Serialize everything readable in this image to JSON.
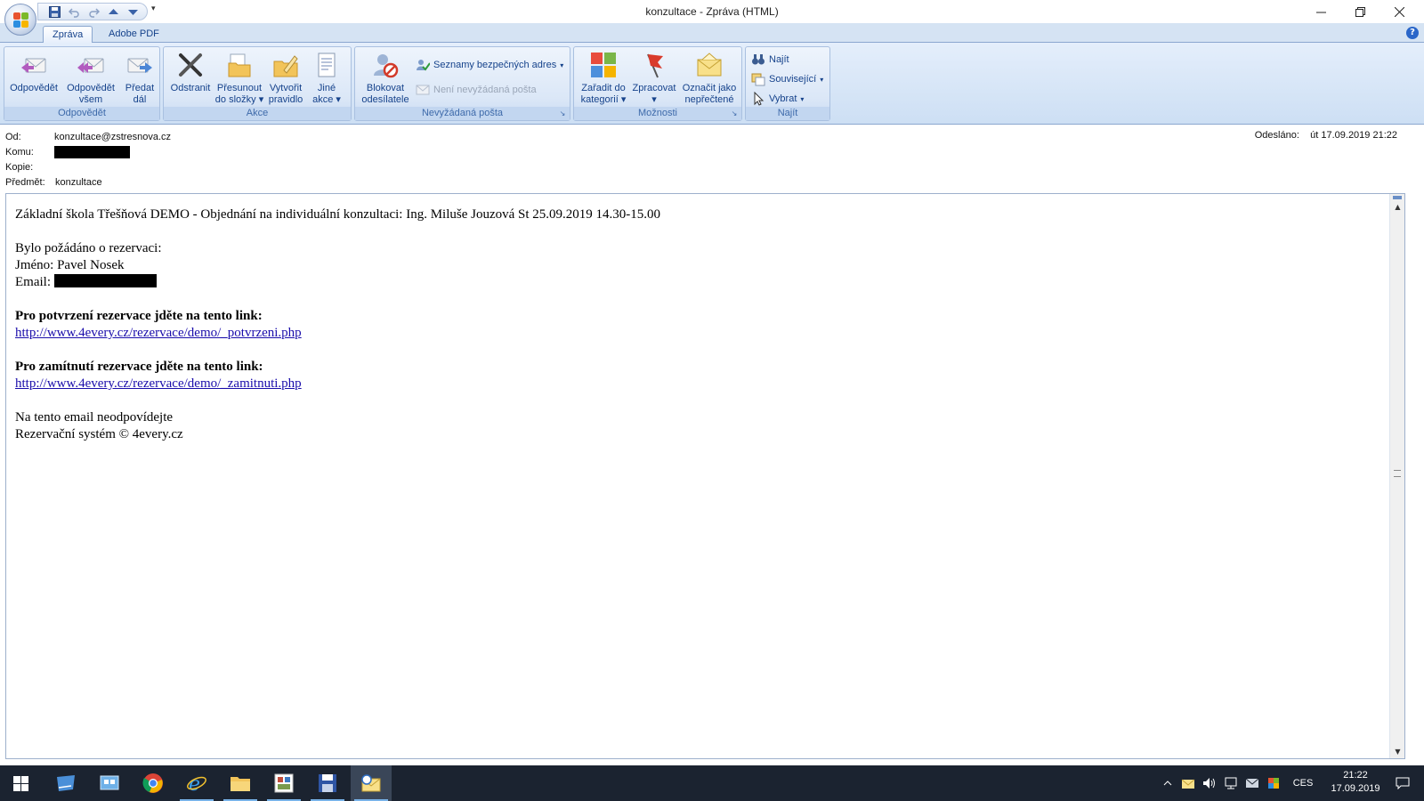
{
  "window": {
    "title": "konzultace - Zpráva (HTML)",
    "quick_access_more": "▾"
  },
  "ribbon": {
    "tabs": [
      {
        "label": "Zpráva",
        "active": true
      },
      {
        "label": "Adobe PDF",
        "active": false
      }
    ],
    "groups": {
      "respond": {
        "label": "Odpovědět",
        "reply": [
          "Odpovědět",
          ""
        ],
        "reply_all": [
          "Odpovědět",
          "všem"
        ],
        "forward": [
          "Předat",
          "dál"
        ]
      },
      "actions": {
        "label": "Akce",
        "delete": [
          "Odstranit",
          ""
        ],
        "move": [
          "Přesunout",
          "do složky"
        ],
        "rule": [
          "Vytvořit",
          "pravidlo"
        ],
        "other": [
          "Jiné",
          "akce"
        ]
      },
      "junk": {
        "label": "Nevyžádaná pošta",
        "block": [
          "Blokovat",
          "odesílatele"
        ],
        "safe_lists": "Seznamy bezpečných adres",
        "not_junk": "Není nevyžádaná pošta"
      },
      "options": {
        "label": "Možnosti",
        "categorize": [
          "Zařadit do",
          "kategorií"
        ],
        "follow_up": [
          "Zpracovat",
          ""
        ],
        "mark_unread": [
          "Označit jako",
          "nepřečtené"
        ]
      },
      "find": {
        "label": "Najít",
        "find": "Najít",
        "related": "Související",
        "select": "Vybrat"
      }
    }
  },
  "header": {
    "from_label": "Od:",
    "from_value": "konzultace@zstresnova.cz",
    "to_label": "Komu:",
    "cc_label": "Kopie:",
    "subject_label": "Předmět:",
    "subject_value": "konzultace",
    "sent_label": "Odesláno:",
    "sent_value": "út 17.09.2019 21:22"
  },
  "message": {
    "line1": "Základní škola Třešňová DEMO - Objednání na individuální konzultaci: Ing. Miluše Jouzová St 25.09.2019 14.30-15.00",
    "line2": "Bylo požádáno o rezervaci:",
    "name_line": "Jméno: Pavel Nosek",
    "email_label": "Email:",
    "confirm_heading": "Pro potvrzení rezervace jděte na tento link:",
    "confirm_link": "http://www.4every.cz/rezervace/demo/_potvrzeni.php",
    "reject_heading": "Pro zamítnutí rezervace jděte na tento link:",
    "reject_link": "http://www.4every.cz/rezervace/demo/_zamitnuti.php",
    "footer1": "Na tento email neodpovídejte",
    "footer2": "Rezervační systém © 4every.cz"
  },
  "taskbar": {
    "language": "CES",
    "time": "21:22",
    "date": "17.09.2019"
  }
}
